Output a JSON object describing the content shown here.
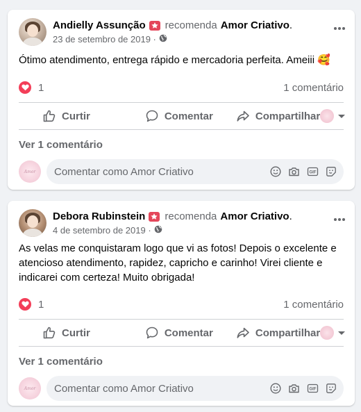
{
  "posts": [
    {
      "author": "Andielly Assunção",
      "verb": "recomenda",
      "page": "Amor Criativo",
      "period": ".",
      "date": "23 de setembro de 2019 ·",
      "text": "Ótimo atendimento, entrega rápido e mercadoria perfeita. Ameiii 🥰",
      "reactions": "1",
      "comments": "1 comentário",
      "actions": {
        "like": "Curtir",
        "comment": "Comentar",
        "share": "Compartilhar"
      },
      "view_comments": "Ver 1 comentário",
      "comment_placeholder": "Comentar como Amor Criativo",
      "commenter_logo_text": "Amor"
    },
    {
      "author": "Debora Rubinstein",
      "verb": "recomenda",
      "page": "Amor Criativo",
      "period": ".",
      "date": "4 de setembro de 2019 ·",
      "text": "As velas me conquistaram logo que vi as fotos! Depois o excelente e atencioso atendimento, rapidez, capricho e carinho! Virei cliente e indicarei com certeza! Muito obrigada!",
      "reactions": "1",
      "comments": "1 comentário",
      "actions": {
        "like": "Curtir",
        "comment": "Comentar",
        "share": "Compartilhar"
      },
      "view_comments": "Ver 1 comentário",
      "comment_placeholder": "Comentar como Amor Criativo",
      "commenter_logo_text": "Amor"
    }
  ],
  "colors": {
    "background": "#f0f2f5",
    "recommend_badge": "#e4465a",
    "heart_reaction": "#f33e58",
    "secondary_text": "#65676b"
  },
  "icons": [
    "recommend-badge-icon",
    "globe-icon",
    "more-options-icon",
    "heart-reaction-icon",
    "like-icon",
    "comment-icon",
    "share-icon",
    "emoji-icon",
    "camera-icon",
    "gif-icon",
    "sticker-icon"
  ]
}
